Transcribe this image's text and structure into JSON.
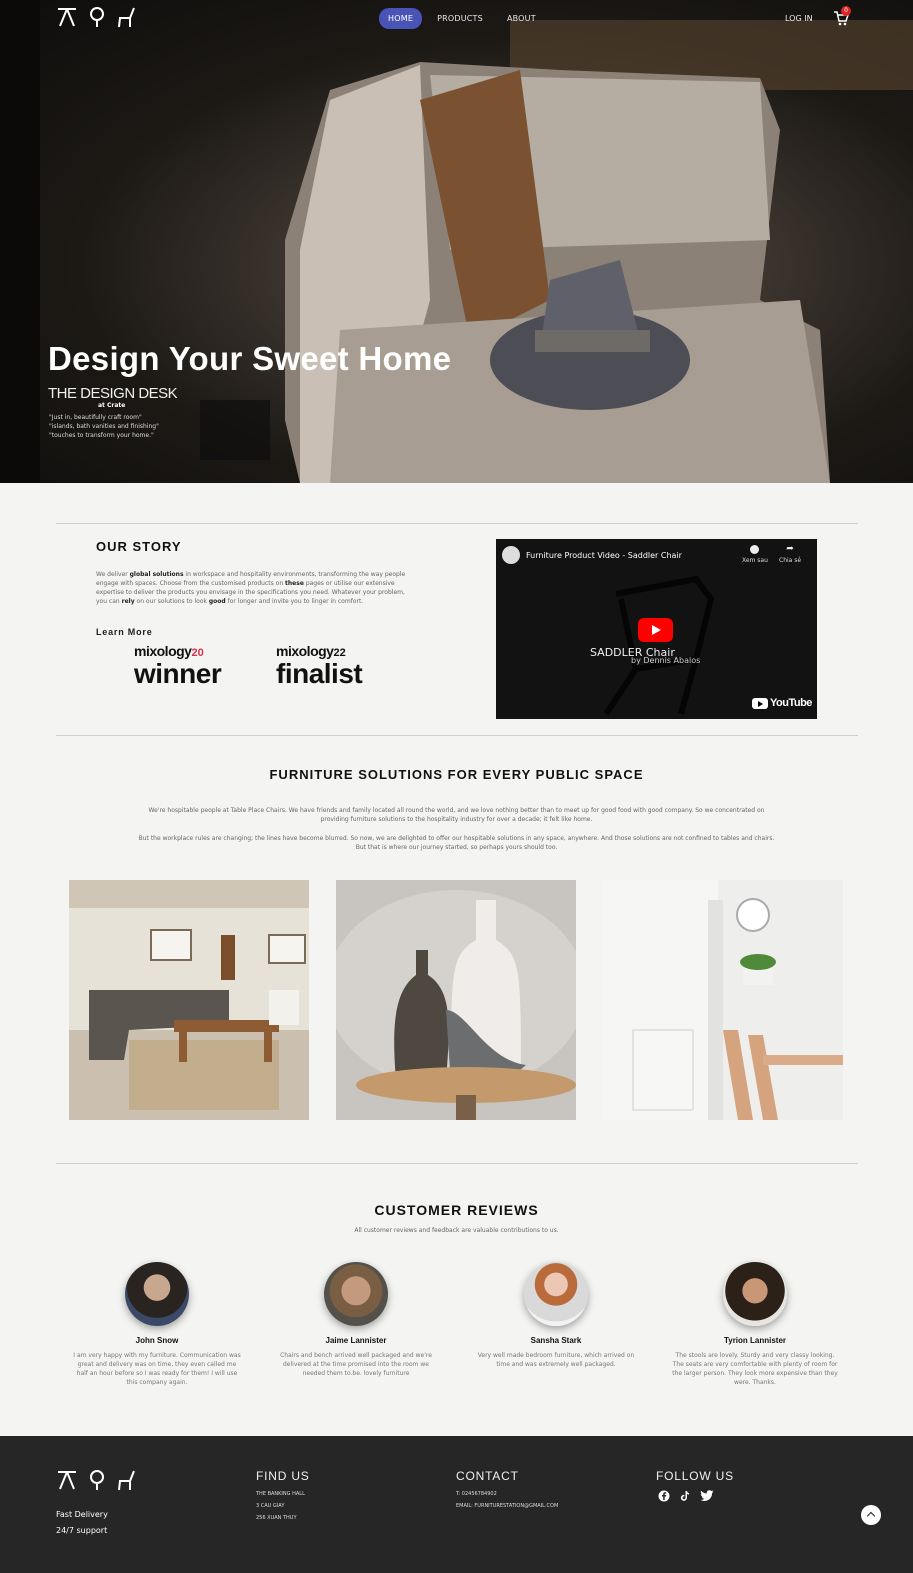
{
  "nav": {
    "links": [
      "HOME",
      "PRODUCTS",
      "ABOUT"
    ],
    "login": "LOG IN",
    "cart_count": "0"
  },
  "hero": {
    "title": "Design Your Sweet Home",
    "subtitle": "THE DESIGN DESK",
    "at": "at Crate",
    "desc": [
      "\"Just in, beautifully craft room\"",
      "\"islands, bath vanities and finishing\"",
      "\"touches to transform your home.\""
    ]
  },
  "story": {
    "title": "OUR STORY",
    "text_parts": {
      "p1": "We deliver ",
      "b1": "global solutions",
      "p2": " in workspace and hospitality environments, transforming the way people engage with spaces. Choose from the customised products on ",
      "b2": "these",
      "p3": " pages or utilise our extensive expertise to deliver the products you envisage in the specifications you need. Whatever your problem, you can ",
      "b3": "rely",
      "p4": " on our solutions to look ",
      "b4": "good",
      "p5": " for longer and invite you to linger in comfort."
    },
    "learn_more": "Learn More",
    "awards": [
      {
        "brand": "mixology",
        "year": "20",
        "label": "winner"
      },
      {
        "brand": "mixology",
        "year": "22",
        "label": "finalist"
      }
    ]
  },
  "video": {
    "title": "Furniture Product Video - Saddler Chair",
    "watch_later": "Xem sau",
    "share": "Chia sẻ",
    "caption": "SADDLER Chair",
    "byline": "by Dennis Abalos",
    "platform": "YouTube"
  },
  "solutions": {
    "title": "FURNITURE SOLUTIONS FOR EVERY PUBLIC SPACE",
    "p1": "We're hospitable people at Table Place Chairs. We have friends and family located all round the world, and we love nothing better than to meet up for good food with good company. So we concentrated on providing furniture solutions to the hospitality industry for over a decade; it felt like home.",
    "p2": "But the workplace rules are changing; the lines have become blurred. So now, we are delighted to offer our hospitable solutions in any space, anywhere. And those solutions are not confined to tables and chairs. But that is where our journey started, so perhaps yours should too."
  },
  "reviews": {
    "title": "CUSTOMER REVIEWS",
    "subtitle": "All customer reviews and feedback are valuable contributions to us.",
    "items": [
      {
        "name": "John Snow",
        "text": "I am very happy with my furniture. Communication was great and delivery was on time, they even called me half an hour before so I was ready for them! I will use this company again."
      },
      {
        "name": "Jaime Lannister",
        "text": "Chairs and bench arrived well packaged and we're delivered at the time promised into the room we needed them to.be. lovely furniture"
      },
      {
        "name": "Sansha Stark",
        "text": "Very well made bedroom furniture, which arrived on time and was extremely well packaged."
      },
      {
        "name": "Tyrion Lannister",
        "text": "The stools are lovely. Sturdy and very classy looking. The seats are very comfortable with plenty of room for the larger person. They look more expensive than they were. Thanks."
      }
    ]
  },
  "footer": {
    "fast": "Fast Delivery",
    "support": "24/7 support",
    "find_us": {
      "title": "FIND US",
      "lines": [
        "THE BANKING HALL",
        "3 CAU GIAY",
        "256 XUAN THUY"
      ]
    },
    "contact": {
      "title": "CONTACT",
      "lines": [
        "T: 02456784902",
        "EMAIL: FURNITURESTATION@GMAIL.COM"
      ]
    },
    "follow": {
      "title": "FOLLOW US",
      "icons": [
        "facebook-icon",
        "tiktok-icon",
        "twitter-icon"
      ]
    }
  }
}
